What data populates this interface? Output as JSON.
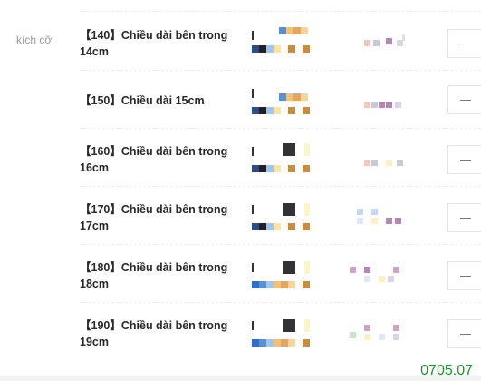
{
  "section": {
    "label": "kích cỡ"
  },
  "sizes": [
    {
      "name": "【140】Chiều dài bên trong 14cm",
      "quantity_control": "−"
    },
    {
      "name": "【150】Chiều dài 15cm",
      "quantity_control": "−"
    },
    {
      "name": "【160】Chiều dài bên trong 16cm",
      "quantity_control": "−"
    },
    {
      "name": "【170】Chiều dài bên trong 17cm",
      "quantity_control": "−"
    },
    {
      "name": "【180】Chiều dài bên trong 18cm",
      "quantity_control": "−"
    },
    {
      "name": "【190】Chiều dài bên trong 19cm",
      "quantity_control": "−"
    }
  ],
  "watermark": "0705.07",
  "icons": {
    "thumbnail": "product-swatch-thumbnail",
    "price": "blurred-price",
    "stepper": "minus-icon"
  }
}
